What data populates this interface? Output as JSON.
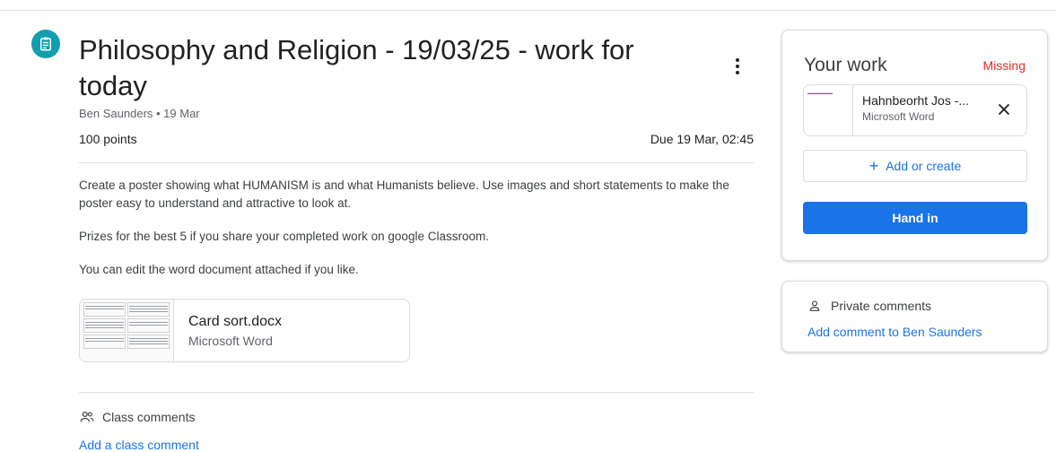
{
  "assignment": {
    "title": "Philosophy and Religion - 19/03/25 - work for today",
    "meta": "Ben Saunders • 19 Mar",
    "points": "100 points",
    "due": "Due 19 Mar, 02:45",
    "description": [
      "Create a poster showing what HUMANISM is and what Humanists believe. Use images and short statements to make the poster easy to understand and attractive to look at.",
      "Prizes for the best 5 if you share your completed work on google Classroom.",
      "You can edit the word document attached if you like."
    ],
    "attachment": {
      "name": "Card sort.docx",
      "type": "Microsoft Word"
    }
  },
  "class_comments": {
    "label": "Class comments",
    "add_link": "Add a class comment"
  },
  "your_work": {
    "title": "Your work",
    "status": "Missing",
    "status_color": "#d93025",
    "file": {
      "name": "Hahnbeorht Jos -...",
      "type": "Microsoft Word"
    },
    "add_create_label": "Add or create",
    "hand_in_label": "Hand in",
    "accent_color": "#1a73e8"
  },
  "private_comments": {
    "label": "Private comments",
    "add_link": "Add comment to Ben Saunders"
  }
}
